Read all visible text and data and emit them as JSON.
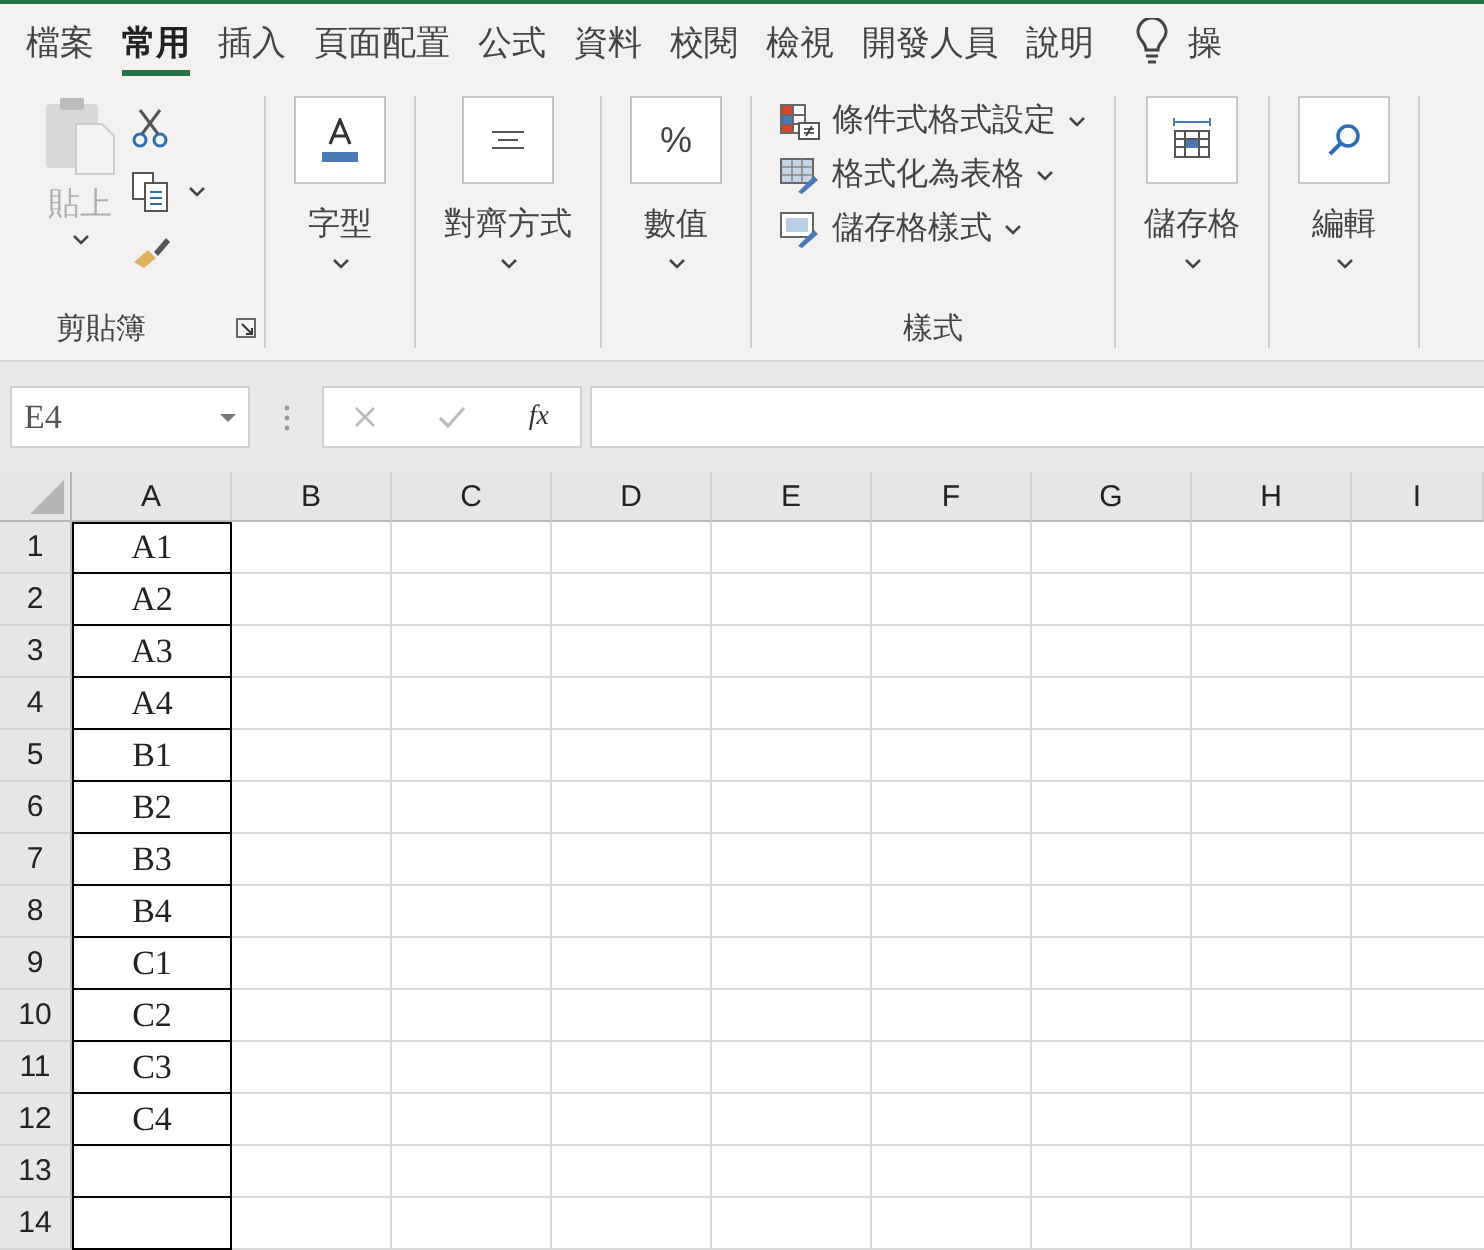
{
  "ribbon_tabs": [
    {
      "label": "檔案",
      "selected": false
    },
    {
      "label": "常用",
      "selected": true
    },
    {
      "label": "插入",
      "selected": false
    },
    {
      "label": "頁面配置",
      "selected": false
    },
    {
      "label": "公式",
      "selected": false
    },
    {
      "label": "資料",
      "selected": false
    },
    {
      "label": "校閱",
      "selected": false
    },
    {
      "label": "檢視",
      "selected": false
    },
    {
      "label": "開發人員",
      "selected": false
    },
    {
      "label": "說明",
      "selected": false
    }
  ],
  "tell_me": {
    "label": "操"
  },
  "ribbon_groups": [
    {
      "kind": "clipboard",
      "paste_label": "貼上",
      "paste_disabled": true,
      "label": "剪貼簿"
    },
    {
      "kind": "big",
      "label": "字型"
    },
    {
      "kind": "big",
      "label": "對齊方式"
    },
    {
      "kind": "big",
      "glyph": "%",
      "label": "數值"
    },
    {
      "kind": "styles",
      "items": [
        {
          "label": "條件式格式設定"
        },
        {
          "label": "格式化為表格"
        },
        {
          "label": "儲存格樣式"
        }
      ],
      "label": "樣式"
    },
    {
      "kind": "big",
      "label": "儲存格"
    },
    {
      "kind": "big",
      "label": "編輯"
    }
  ],
  "name_box": {
    "value": "E4"
  },
  "formula_bar": {
    "function_label": "fx"
  },
  "sheet": {
    "columns": [
      "A",
      "B",
      "C",
      "D",
      "E",
      "F",
      "G",
      "H",
      "I"
    ],
    "rows": [
      {
        "header": "1",
        "value": "A1",
        "bordered": true
      },
      {
        "header": "2",
        "value": "A2",
        "bordered": true
      },
      {
        "header": "3",
        "value": "A3",
        "bordered": true
      },
      {
        "header": "4",
        "value": "A4",
        "bordered": true
      },
      {
        "header": "5",
        "value": "B1",
        "bordered": true
      },
      {
        "header": "6",
        "value": "B2",
        "bordered": true
      },
      {
        "header": "7",
        "value": "B3",
        "bordered": true
      },
      {
        "header": "8",
        "value": "B4",
        "bordered": true
      },
      {
        "header": "9",
        "value": "C1",
        "bordered": true
      },
      {
        "header": "10",
        "value": "C2",
        "bordered": true
      },
      {
        "header": "11",
        "value": "C3",
        "bordered": true
      },
      {
        "header": "12",
        "value": "C4",
        "bordered": true
      },
      {
        "header": "13",
        "bordered": true
      },
      {
        "header": "14",
        "bordered": true
      }
    ]
  }
}
